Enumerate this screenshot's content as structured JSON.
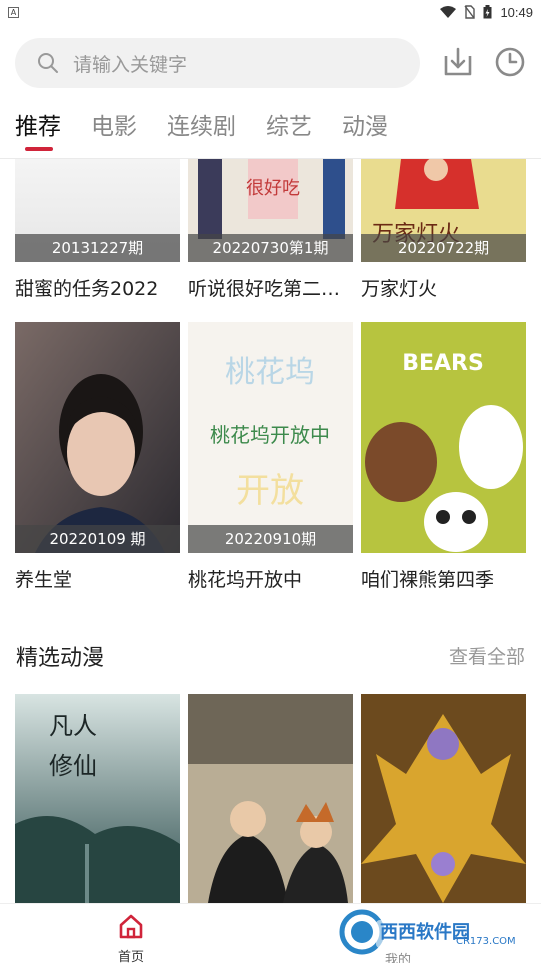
{
  "status_bar": {
    "app_badge": "A",
    "time": "10:49"
  },
  "search": {
    "placeholder": "请输入关键字"
  },
  "tabs": [
    {
      "label": "推荐",
      "active": true
    },
    {
      "label": "电影"
    },
    {
      "label": "连续剧"
    },
    {
      "label": "综艺"
    },
    {
      "label": "动漫"
    }
  ],
  "grid": [
    {
      "title": "甜蜜的任务2022",
      "badge": "20131227期"
    },
    {
      "title": "听说很好吃第二…",
      "badge": "20220730第1期"
    },
    {
      "title": "万家灯火",
      "badge": "20220722期"
    },
    {
      "title": "养生堂",
      "badge": "20220109 期"
    },
    {
      "title": "桃花坞开放中",
      "badge": "20220910期"
    },
    {
      "title": "咱们裸熊第四季",
      "badge": ""
    }
  ],
  "section": {
    "title": "精选动漫",
    "see_all": "查看全部"
  },
  "bottom_nav": {
    "home": "首页",
    "mine": "我的"
  },
  "watermark": {
    "brand": "西西软件园",
    "url": "CR173.COM"
  },
  "colors": {
    "accent": "#d0243a"
  }
}
